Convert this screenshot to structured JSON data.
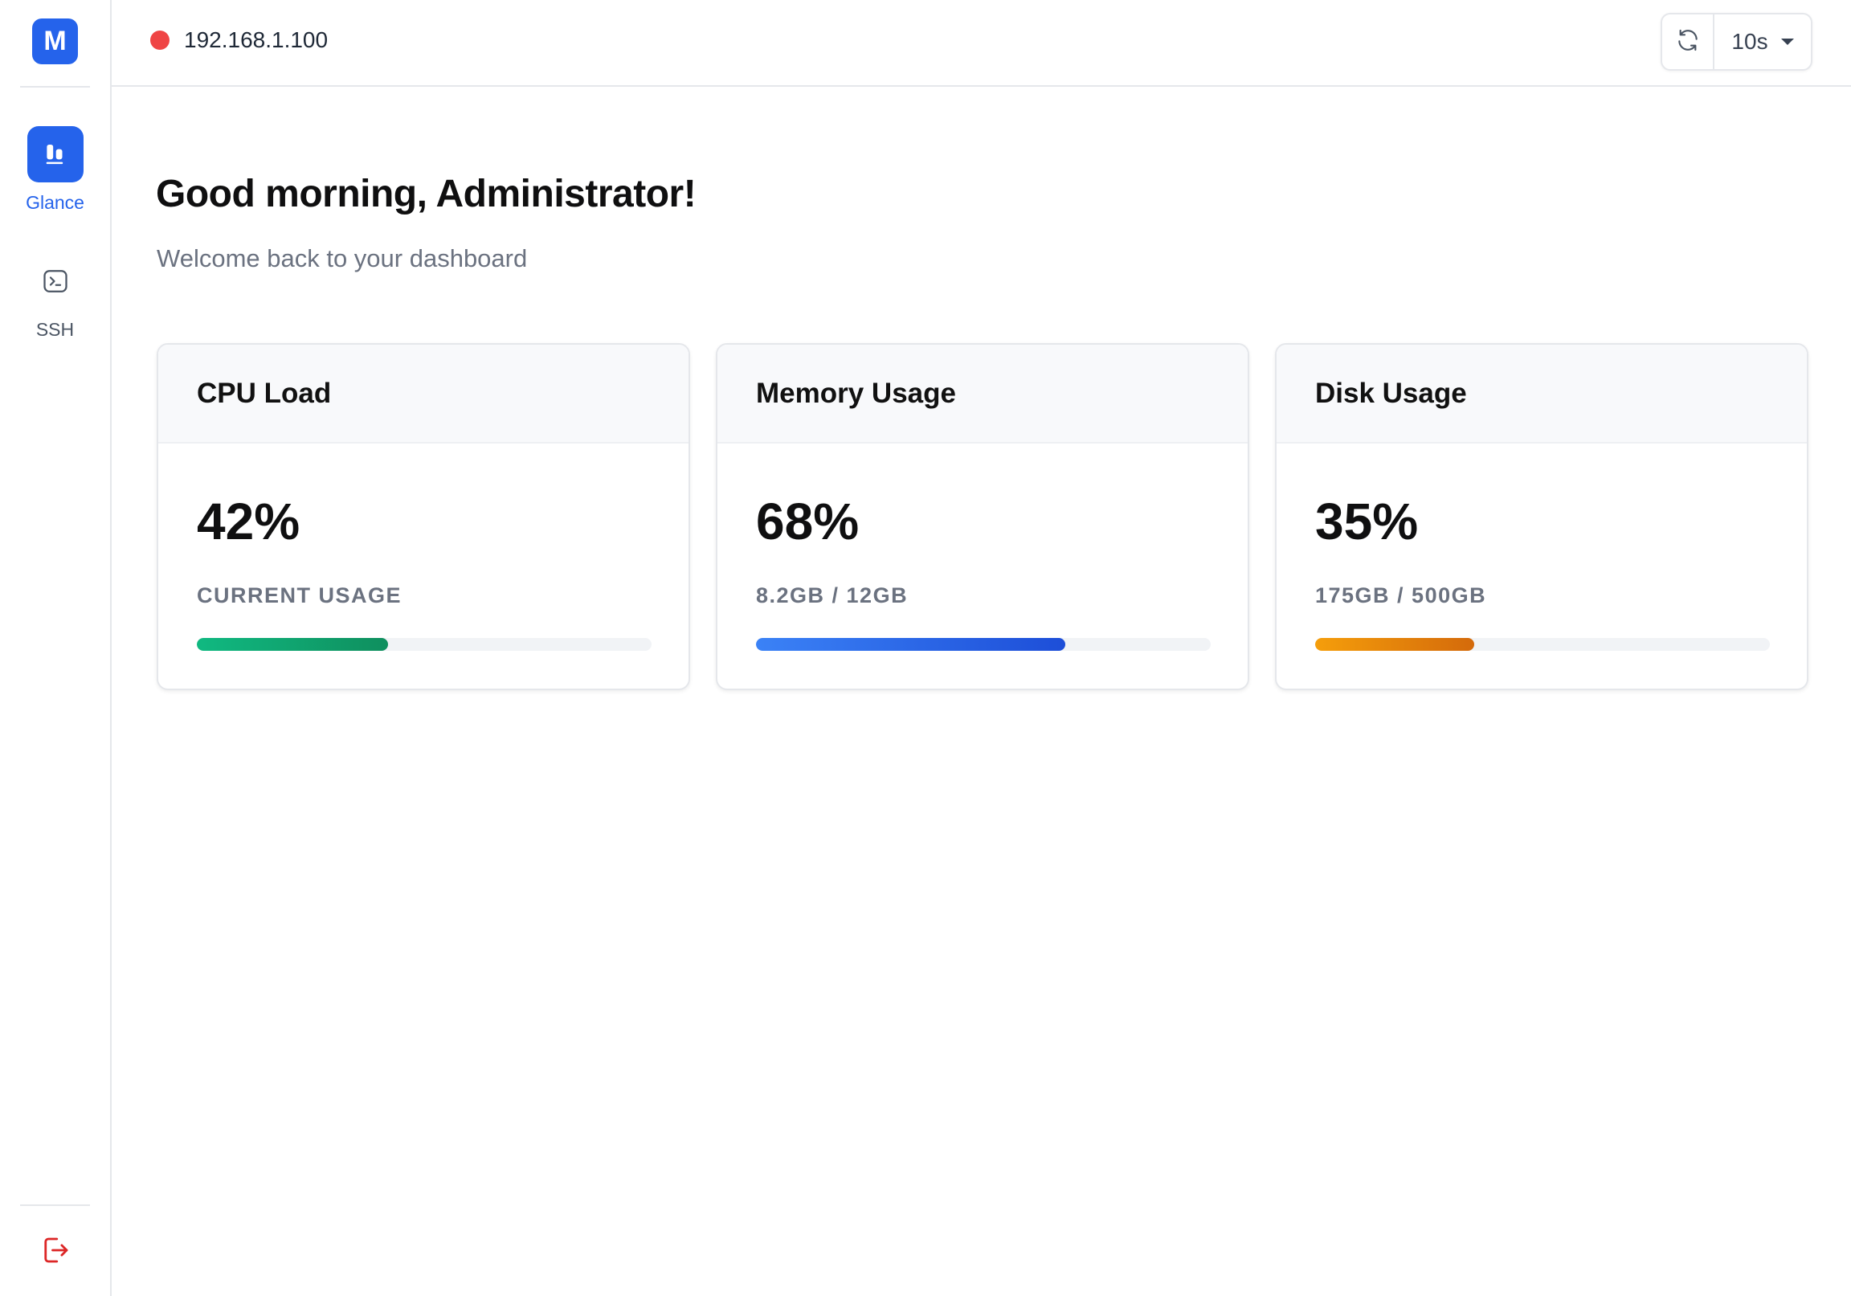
{
  "sidebar": {
    "logo_letter": "M",
    "items": [
      {
        "label": "Glance",
        "icon": "bar-chart-icon",
        "active": true
      },
      {
        "label": "SSH",
        "icon": "terminal-icon",
        "active": false
      }
    ],
    "logout_icon": "logout-icon"
  },
  "header": {
    "status_color": "#ef4444",
    "host": "192.168.1.100",
    "refresh_icon": "refresh-icon",
    "interval": "10s"
  },
  "main": {
    "greeting": "Good morning, Administrator!",
    "subtitle": "Welcome back to your dashboard",
    "cards": [
      {
        "title": "CPU Load",
        "value": "42%",
        "detail": "CURRENT USAGE",
        "progress_percent": 42,
        "color_start": "#10b981",
        "color_end": "#0f8f5e"
      },
      {
        "title": "Memory Usage",
        "value": "68%",
        "detail": "8.2GB / 12GB",
        "progress_percent": 68,
        "color_start": "#3b82f6",
        "color_end": "#1d4ed8"
      },
      {
        "title": "Disk Usage",
        "value": "35%",
        "detail": "175GB / 500GB",
        "progress_percent": 35,
        "color_start": "#f59e0b",
        "color_end": "#d46a0b"
      }
    ]
  },
  "colors": {
    "accent": "#2563eb",
    "logout": "#dc2626"
  }
}
